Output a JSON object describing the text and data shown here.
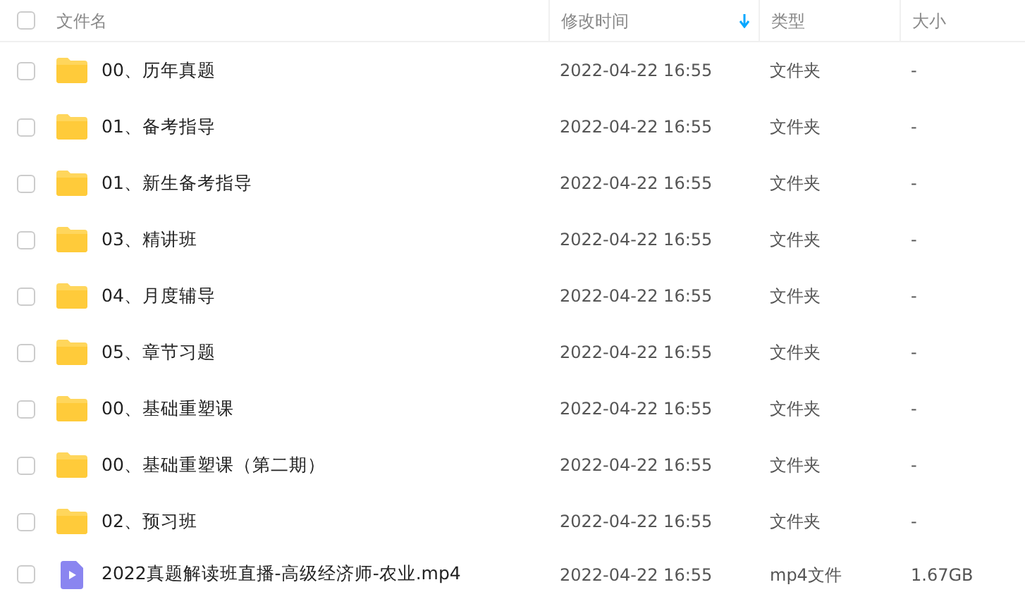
{
  "table": {
    "all_checked": false,
    "columns": [
      {
        "label": "文件名",
        "sorted": false
      },
      {
        "label": "修改时间",
        "sorted": true
      },
      {
        "label": "类型",
        "sorted": false
      },
      {
        "label": "大小",
        "sorted": false
      }
    ],
    "rows": [
      {
        "kind": "folder",
        "checked": false,
        "name": "00、历年真题",
        "modified": "2022-04-22 16:55",
        "type": "文件夹",
        "size": "-"
      },
      {
        "kind": "folder",
        "checked": false,
        "name": "01、备考指导",
        "modified": "2022-04-22 16:55",
        "type": "文件夹",
        "size": "-"
      },
      {
        "kind": "folder",
        "checked": false,
        "name": "01、新生备考指导",
        "modified": "2022-04-22 16:55",
        "type": "文件夹",
        "size": "-"
      },
      {
        "kind": "folder",
        "checked": false,
        "name": "03、精讲班",
        "modified": "2022-04-22 16:55",
        "type": "文件夹",
        "size": "-"
      },
      {
        "kind": "folder",
        "checked": false,
        "name": "04、月度辅导",
        "modified": "2022-04-22 16:55",
        "type": "文件夹",
        "size": "-"
      },
      {
        "kind": "folder",
        "checked": false,
        "name": "05、章节习题",
        "modified": "2022-04-22 16:55",
        "type": "文件夹",
        "size": "-"
      },
      {
        "kind": "folder",
        "checked": false,
        "name": "00、基础重塑课",
        "modified": "2022-04-22 16:55",
        "type": "文件夹",
        "size": "-"
      },
      {
        "kind": "folder",
        "checked": false,
        "name": "00、基础重塑课（第二期）",
        "modified": "2022-04-22 16:55",
        "type": "文件夹",
        "size": "-"
      },
      {
        "kind": "folder",
        "checked": false,
        "name": "02、预习班",
        "modified": "2022-04-22 16:55",
        "type": "文件夹",
        "size": "-"
      },
      {
        "kind": "video",
        "checked": false,
        "name": "2022真题解读班直播-高级经济师-农业.mp4",
        "modified": "2022-04-22 16:55",
        "type": "mp4文件",
        "size": "1.67GB"
      }
    ]
  }
}
